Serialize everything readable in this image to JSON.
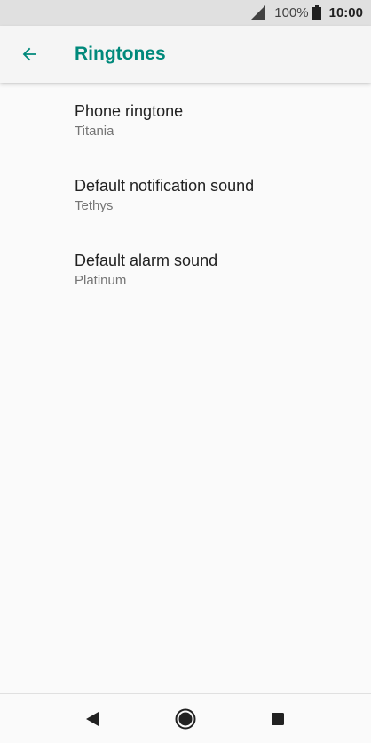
{
  "status_bar": {
    "battery_percent": "100%",
    "time": "10:00"
  },
  "app_bar": {
    "title": "Ringtones",
    "back_icon": "arrow-back-icon"
  },
  "settings": [
    {
      "title": "Phone ringtone",
      "summary": "Titania"
    },
    {
      "title": "Default notification sound",
      "summary": "Tethys"
    },
    {
      "title": "Default alarm sound",
      "summary": "Platinum"
    }
  ],
  "nav_bar": {
    "back_icon": "triangle-back-icon",
    "home_icon": "circle-home-icon",
    "recents_icon": "square-recents-icon"
  },
  "colors": {
    "accent": "#00897b",
    "status_bar": "#e0e0e0",
    "app_bar": "#f5f5f5",
    "background": "#fafafa"
  }
}
